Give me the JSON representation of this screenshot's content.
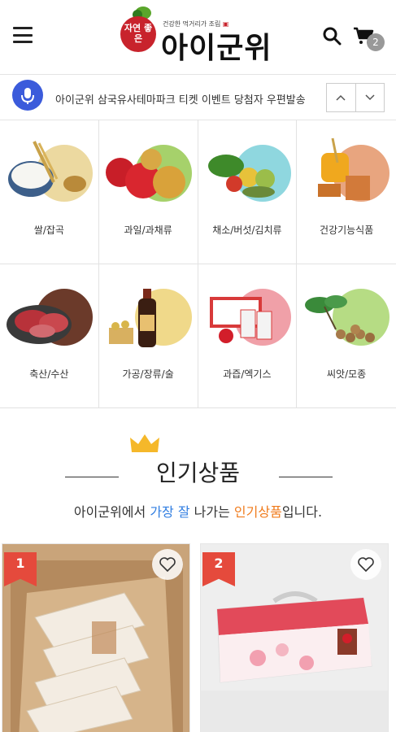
{
  "header": {
    "logo_emblem": "자연 좋은",
    "logo_tagline_prefix": "건강한 먹거리가 조림",
    "logo_tagline_badge": "▣",
    "logo_text": "아이군위",
    "cart_count": "2"
  },
  "notice": {
    "text": "아이군위 삼국유사테마파크 티켓 이벤트 당첨자 우편발송",
    "prev_icon": "chevron-up-icon",
    "next_icon": "chevron-down-icon"
  },
  "categories": [
    {
      "label": "쌀/잡곡",
      "circle_color": "#ecd9a0"
    },
    {
      "label": "과일/과채류",
      "circle_color": "#a6d16b"
    },
    {
      "label": "채소/버섯/김치류",
      "circle_color": "#8fd7df"
    },
    {
      "label": "건강기능식품",
      "circle_color": "#e8a57f"
    },
    {
      "label": "축산/수산",
      "circle_color": "#6b3a2a"
    },
    {
      "label": "가공/장류/술",
      "circle_color": "#f0d98a"
    },
    {
      "label": "과즙/엑기스",
      "circle_color": "#f0a0a8"
    },
    {
      "label": "씨앗/모종",
      "circle_color": "#b6dc84"
    }
  ],
  "popular": {
    "title": "인기상품",
    "sub_prefix": "아이군위에서 ",
    "sub_blue": "가장 잘",
    "sub_mid": " 나가는 ",
    "sub_orange": "인기상품",
    "sub_suffix": "입니다."
  },
  "products": [
    {
      "rank": "1"
    },
    {
      "rank": "2"
    }
  ],
  "colors": {
    "accent_blue": "#2f7de1",
    "accent_orange": "#f07b1c",
    "rank_red": "#e54a3c",
    "mic_blue": "#3b5bdb"
  }
}
